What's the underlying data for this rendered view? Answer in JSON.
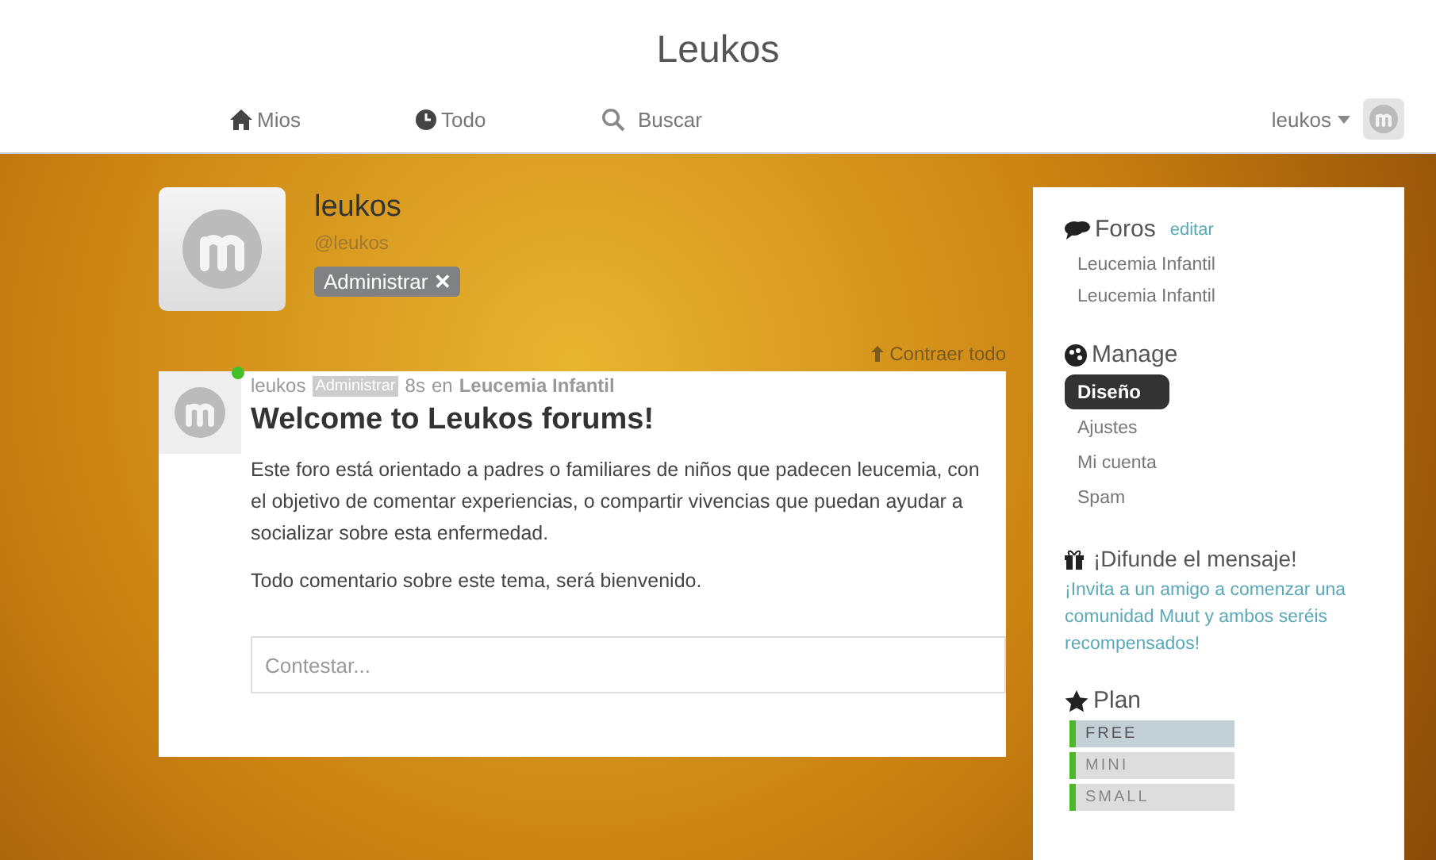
{
  "header": {
    "title": "Leukos"
  },
  "nav": [
    {
      "label": "Mios"
    },
    {
      "label": "Todo"
    },
    {
      "label": "Buscar"
    }
  ],
  "user_menu": {
    "label": "leukos"
  },
  "profile": {
    "name": "leukos",
    "handle": "@leukos",
    "admin_label": "Administrar",
    "close": "✕"
  },
  "collapse": {
    "label": "Contraer todo"
  },
  "post": {
    "author": "leukos",
    "badge": "Administrar",
    "online": true,
    "time": "8s",
    "preposition": "en",
    "forum": "Leucemia Infantil",
    "title": "Welcome to Leukos forums!",
    "paragraphs": [
      "Este foro está orientado a padres o familiares de niños que padecen leucemia, con el objetivo de comentar experiencias, o compartir vivencias que puedan ayudar a socializar sobre esta enfermedad.",
      "Todo comentario sobre este tema, será bienvenido."
    ],
    "reply": {
      "placeholder": "Contestar..."
    }
  },
  "sidebar": {
    "forums": {
      "title": "Foros",
      "edit": "editar",
      "items": [
        "Leucemia Infantil",
        "Leucemia Infantil"
      ]
    },
    "manage": {
      "title": "Manage",
      "items": [
        {
          "label": "Diseño",
          "selected": true
        },
        {
          "label": "Ajustes",
          "selected": false
        },
        {
          "label": "Mi cuenta",
          "selected": false
        },
        {
          "label": "Spam",
          "selected": false
        }
      ]
    },
    "spread": {
      "title": "¡Difunde el mensaje!",
      "text": "¡Invita a un amigo a comenzar una comunidad Muut y ambos seréis recompensados!"
    },
    "plan": {
      "title": "Plan",
      "items": [
        {
          "label": "FREE",
          "selected": true
        },
        {
          "label": "MINI",
          "selected": false
        },
        {
          "label": "SMALL",
          "selected": false
        }
      ]
    }
  }
}
